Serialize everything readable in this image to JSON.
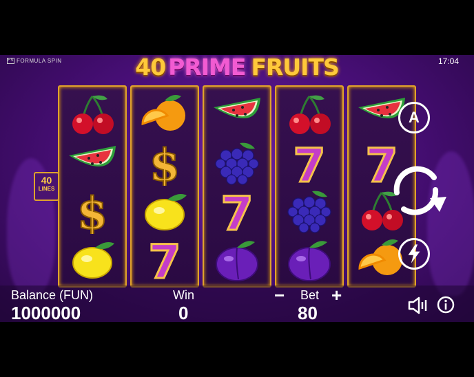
{
  "brand": {
    "label": "FORMULA SPIN"
  },
  "clock": {
    "time": "17:04"
  },
  "game_title": {
    "part1": "40",
    "part2": "PRIME",
    "part3": "FRUITS"
  },
  "lines_badge": {
    "count": "40",
    "label": "LINES"
  },
  "reels": [
    [
      "cherry-icon",
      "watermelon-icon",
      "dollar-icon",
      "lemon-icon"
    ],
    [
      "orange-icon",
      "dollar-icon",
      "lemon-icon",
      "seven-icon"
    ],
    [
      "watermelon-icon",
      "grapes-icon",
      "seven-icon",
      "plum-icon"
    ],
    [
      "cherry-icon",
      "seven-icon",
      "grapes-icon",
      "plum-icon"
    ],
    [
      "watermelon-icon",
      "seven-icon",
      "cherry-icon",
      "orange-icon"
    ]
  ],
  "controls": {
    "auto_label": "A"
  },
  "bottom_bar": {
    "balance_label": "Balance (FUN)",
    "balance_value": "1000000",
    "win_label": "Win",
    "win_value": "0",
    "bet_label": "Bet",
    "bet_value": "80",
    "bet_minus": "−",
    "bet_plus": "+"
  },
  "colors": {
    "accent_gold": "#ffc93a",
    "accent_pink": "#f25bd2",
    "background": "#4a0f7a"
  }
}
